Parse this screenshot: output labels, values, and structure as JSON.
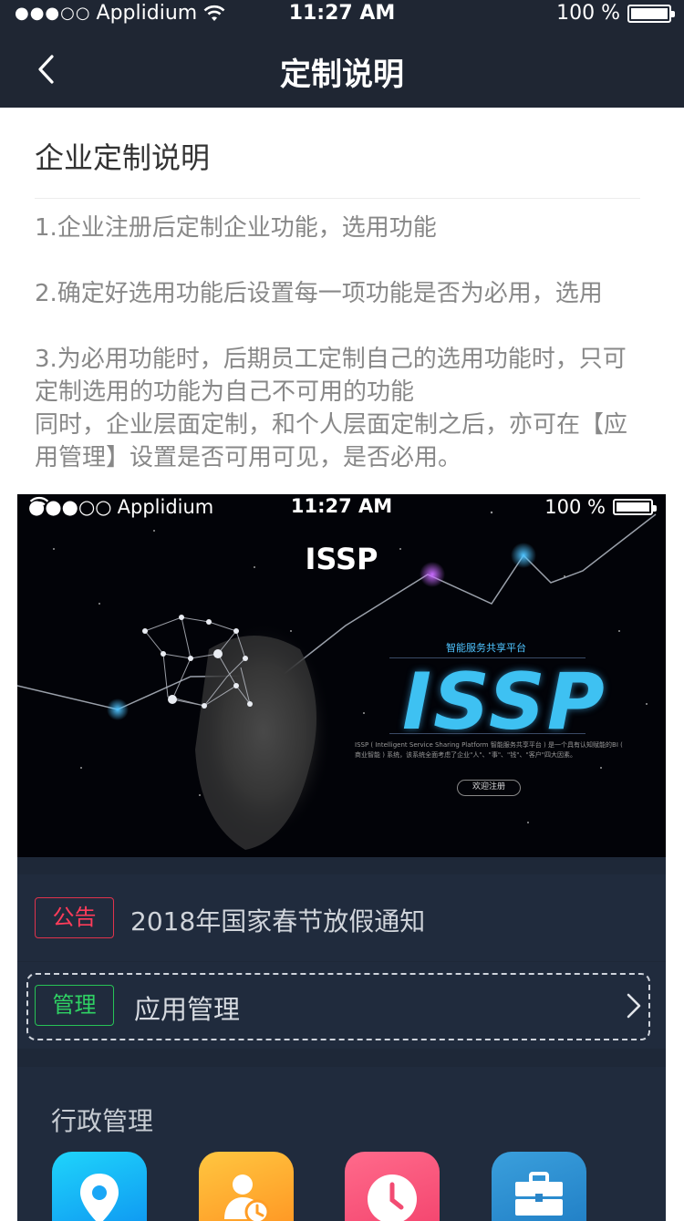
{
  "status_bar": {
    "carrier": "Applidium",
    "signal_dots": "●●●○○",
    "time": "11:27 AM",
    "battery": "100 %"
  },
  "nav": {
    "title": "定制说明",
    "back_icon": "chevron-left-icon"
  },
  "section": {
    "title": "企业定制说明",
    "paragraphs": [
      "1.企业注册后定制企业功能，选用功能",
      "2.确定好选用功能后设置每一项功能是否为必用，选用",
      "3.为必用功能时，后期员工定制自己的选用功能时，只可定制选用的功能为自己不可用的功能\n同时，企业层面定制，和个人层面定制之后，亦可在【应用管理】设置是否可用可见，是否必用。"
    ]
  },
  "screenshot": {
    "status_bar": {
      "carrier": "Applidium",
      "signal_dots": "●●●○○",
      "time": "11:27 AM",
      "battery": "100 %"
    },
    "banner": {
      "title": "ISSP",
      "subtitle": "智能服务共享平台",
      "logo_text": "ISSP",
      "description": "ISSP ( Intelligent Service Sharing Platform 智能服务共享平台 ) 是一个具有认知赋能的BI ( 商业智能 ) 系统，该系统全面考虑了企业\"人\"、\"事\"、\"钱\"、\"客户\"四大因素。",
      "register_button": "欢迎注册"
    },
    "notice": {
      "tag": "公告",
      "text": "2018年国家春节放假通知"
    },
    "manage": {
      "tag": "管理",
      "text": "应用管理"
    },
    "admin": {
      "label": "行政管理",
      "apps": [
        {
          "icon": "location-pin-icon",
          "color": "#18b4f7"
        },
        {
          "icon": "user-clock-icon",
          "color": "#ffb12f"
        },
        {
          "icon": "clock-icon",
          "color": "#f4557a"
        },
        {
          "icon": "briefcase-icon",
          "color": "#2b8dd0"
        }
      ]
    }
  }
}
